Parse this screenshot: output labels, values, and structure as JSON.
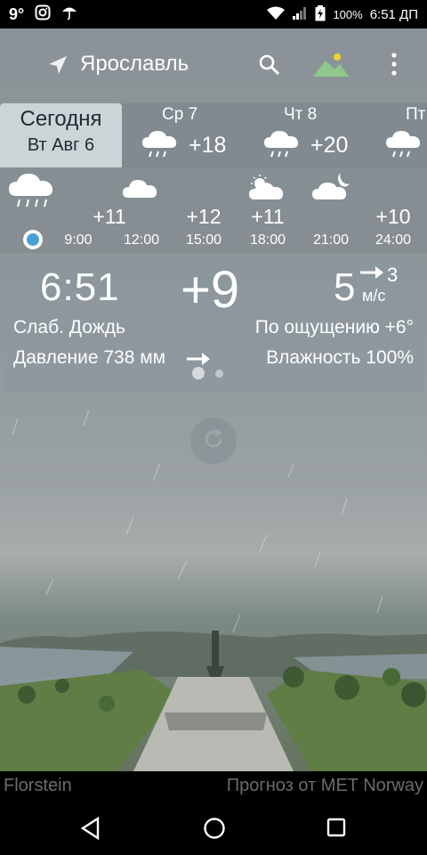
{
  "status_bar": {
    "notif_1": "9°",
    "battery": "100%",
    "time": "6:51 ДП"
  },
  "header": {
    "city": "Ярославль"
  },
  "days": {
    "today": {
      "label": "Сегодня",
      "date": "Вт Авг 6"
    },
    "items": [
      {
        "name": "Ср 7",
        "temp": "+18"
      },
      {
        "name": "Чт 8",
        "temp": "+20"
      },
      {
        "name": "Пт",
        "temp": ""
      }
    ]
  },
  "hourly": [
    {
      "temp": "+11",
      "hour": "9:00"
    },
    {
      "temp": "",
      "hour": "12:00"
    },
    {
      "temp": "+12",
      "hour": "15:00"
    },
    {
      "temp": "+11",
      "hour": "18:00"
    },
    {
      "temp": "",
      "hour": "21:00"
    },
    {
      "temp": "+10",
      "hour": "24:00"
    }
  ],
  "current": {
    "clock": "6:51",
    "temp": "+9",
    "wind_speed": "5",
    "wind_value": "3",
    "wind_unit": "м/с",
    "condition": "Слаб. Дождь",
    "feels_like": "По ощущению +6°",
    "pressure": "Давление 738 мм",
    "humidity": "Влажность 100%"
  },
  "footer": {
    "left": "Florstein",
    "right": "Прогноз от MET Norway"
  },
  "icons": [
    "location-arrow-icon",
    "search-icon",
    "landscape-icon",
    "more-vert-icon",
    "rain-cloud-icon",
    "cloud-icon",
    "partly-cloudy-day-icon",
    "partly-cloudy-night-icon",
    "refresh-icon",
    "back-icon",
    "home-icon",
    "recents-icon"
  ]
}
